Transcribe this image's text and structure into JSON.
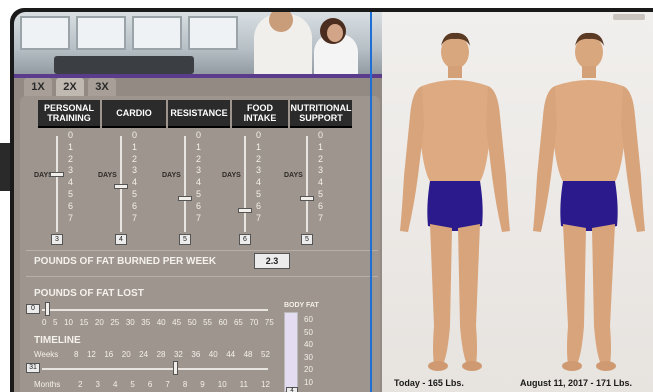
{
  "tabs": [
    {
      "label": "1X",
      "active": false
    },
    {
      "label": "2X",
      "active": true
    },
    {
      "label": "3X",
      "active": false
    }
  ],
  "categories": [
    {
      "label_line1": "PERSONAL",
      "label_line2": "TRAINING",
      "days_label": "DAYS",
      "scale": [
        "0",
        "1",
        "2",
        "3",
        "4",
        "5",
        "6",
        "7"
      ],
      "value": "3"
    },
    {
      "label_line1": "CARDIO",
      "label_line2": "",
      "days_label": "DAYS",
      "scale": [
        "0",
        "1",
        "2",
        "3",
        "4",
        "5",
        "6",
        "7"
      ],
      "value": "4"
    },
    {
      "label_line1": "RESISTANCE",
      "label_line2": "",
      "days_label": "DAYS",
      "scale": [
        "0",
        "1",
        "2",
        "3",
        "4",
        "5",
        "6",
        "7"
      ],
      "value": "5"
    },
    {
      "label_line1": "FOOD",
      "label_line2": "INTAKE",
      "days_label": "DAYS",
      "scale": [
        "0",
        "1",
        "2",
        "3",
        "4",
        "5",
        "6",
        "7"
      ],
      "value": "6"
    },
    {
      "label_line1": "NUTRITIONAL",
      "label_line2": "SUPPORT",
      "days_label": "DAYS",
      "scale": [
        "0",
        "1",
        "2",
        "3",
        "4",
        "5",
        "6",
        "7"
      ],
      "value": "5"
    }
  ],
  "fat_burned": {
    "label": "POUNDS OF FAT BURNED PER WEEK",
    "value": "2.3"
  },
  "fat_lost": {
    "label": "POUNDS OF FAT LOST",
    "value": "0",
    "ticks": [
      "0",
      "5",
      "10",
      "15",
      "20",
      "25",
      "30",
      "35",
      "40",
      "45",
      "50",
      "55",
      "60",
      "65",
      "70",
      "75"
    ]
  },
  "timeline": {
    "label": "TIMELINE",
    "weeks_label": "Weeks",
    "weeks_ticks": [
      "8",
      "12",
      "16",
      "20",
      "24",
      "28",
      "32",
      "36",
      "40",
      "44",
      "48",
      "52"
    ],
    "value": "31",
    "months_label": "Months",
    "months_ticks": [
      "2",
      "3",
      "4",
      "5",
      "6",
      "7",
      "8",
      "9",
      "10",
      "11",
      "12"
    ]
  },
  "body_fat": {
    "label": "BODY FAT",
    "ticks": [
      "60",
      "50",
      "40",
      "30",
      "20",
      "10"
    ],
    "value": "4"
  },
  "figures": [
    {
      "caption": "Today - 165 Lbs."
    },
    {
      "caption": "August 11, 2017 - 171 Lbs."
    }
  ],
  "colors": {
    "panel": "#928a83",
    "header": "#2b2b2b",
    "accent_blue": "#1d6fd6",
    "shorts": "#2a1a8c",
    "skin": "#d9a77e"
  }
}
